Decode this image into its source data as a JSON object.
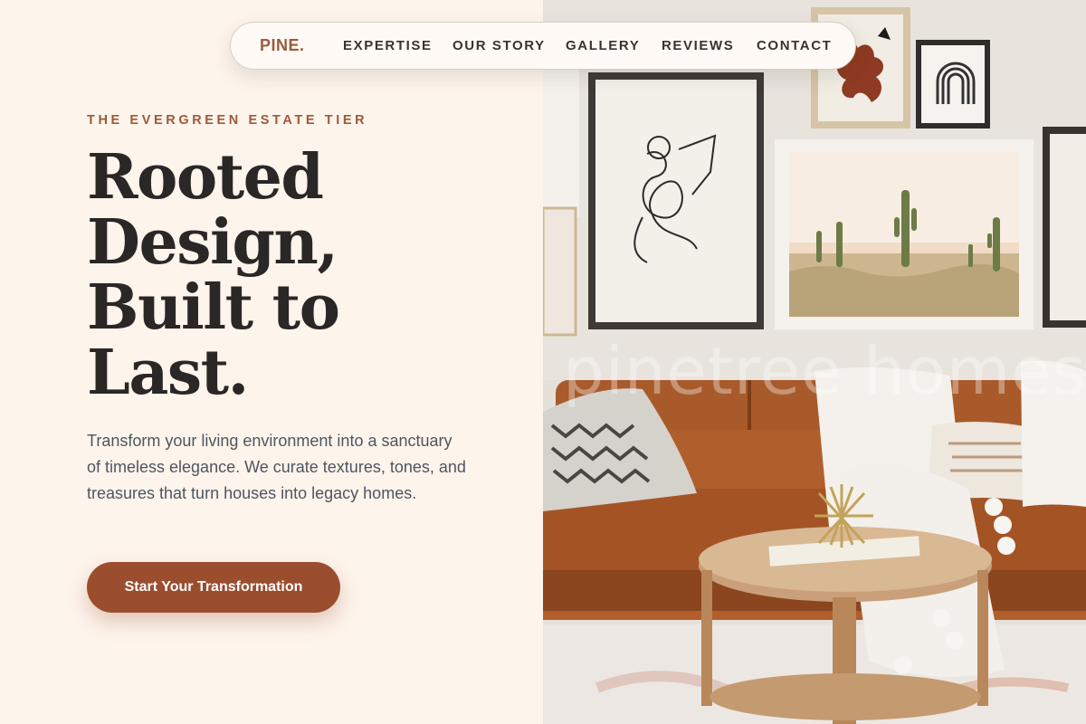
{
  "nav": {
    "brand": "PINE.",
    "links": [
      "EXPERTISE",
      "OUR STORY",
      "GALLERY",
      "REVIEWS",
      "CONTACT"
    ]
  },
  "hero": {
    "eyebrow": "THE EVERGREEN ESTATE TIER",
    "headline_lines": [
      "Rooted",
      "Design,",
      "Built to",
      "Last."
    ],
    "body": "Transform your living environment into a sanctuary of timeless elegance. We curate textures, tones, and treasures that turn houses into legacy homes.",
    "cta_label": "Start Your Transformation"
  },
  "image": {
    "watermark": "pinetree homes",
    "icon": "living-room-photo"
  },
  "colors": {
    "background": "#fdf4ec",
    "accent": "#9a4e2e",
    "heading": "#2a2726",
    "body": "#4f5561"
  }
}
